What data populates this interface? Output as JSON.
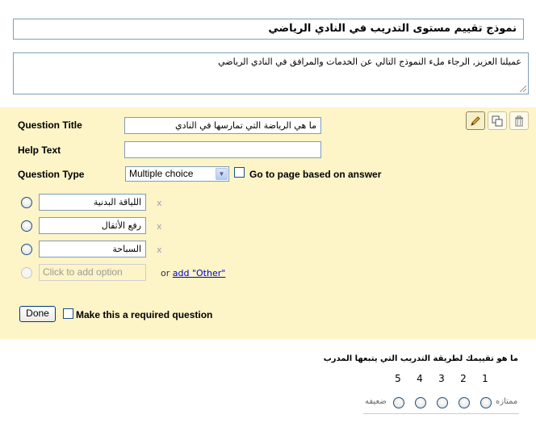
{
  "form": {
    "title": "نموذج تقييم مستوى التدريب في النادي الرياضي",
    "description": "عميلنا العزيز, الرجاء ملء النموذج التالي عن الخدمات والمرافق في النادي الرياضي"
  },
  "editor": {
    "question_title_label": "Question Title",
    "question_title_value": "ما هي الرياضة التي تمارسها في النادي",
    "help_text_label": "Help Text",
    "help_text_value": "",
    "question_type_label": "Question Type",
    "question_type_value": "Multiple choice",
    "goto_page_label": "Go to page based on answer",
    "options": [
      {
        "value": "اللياقة البدنية",
        "remove": "x"
      },
      {
        "value": "رفع الأثقال",
        "remove": "x"
      },
      {
        "value": "السباحة",
        "remove": "x"
      }
    ],
    "add_option_placeholder": "Click to add option",
    "or_text": "or",
    "add_other_link": "add \"Other\"",
    "done_label": "Done",
    "required_label": "Make this a required question",
    "tools": [
      "pencil-icon",
      "duplicate-icon",
      "trash-icon"
    ]
  },
  "preview": {
    "title": "ما هو تقييمك لطريقة التدريب التي يتبعها المدرب",
    "scale": [
      "5",
      "4",
      "3",
      "2",
      "1"
    ],
    "low_label": "ضعيفه",
    "high_label": "ممتازه"
  },
  "colors": {
    "panel_bg": "#fdf4c7",
    "border": "#7f9db9",
    "link": "#0000cc"
  }
}
